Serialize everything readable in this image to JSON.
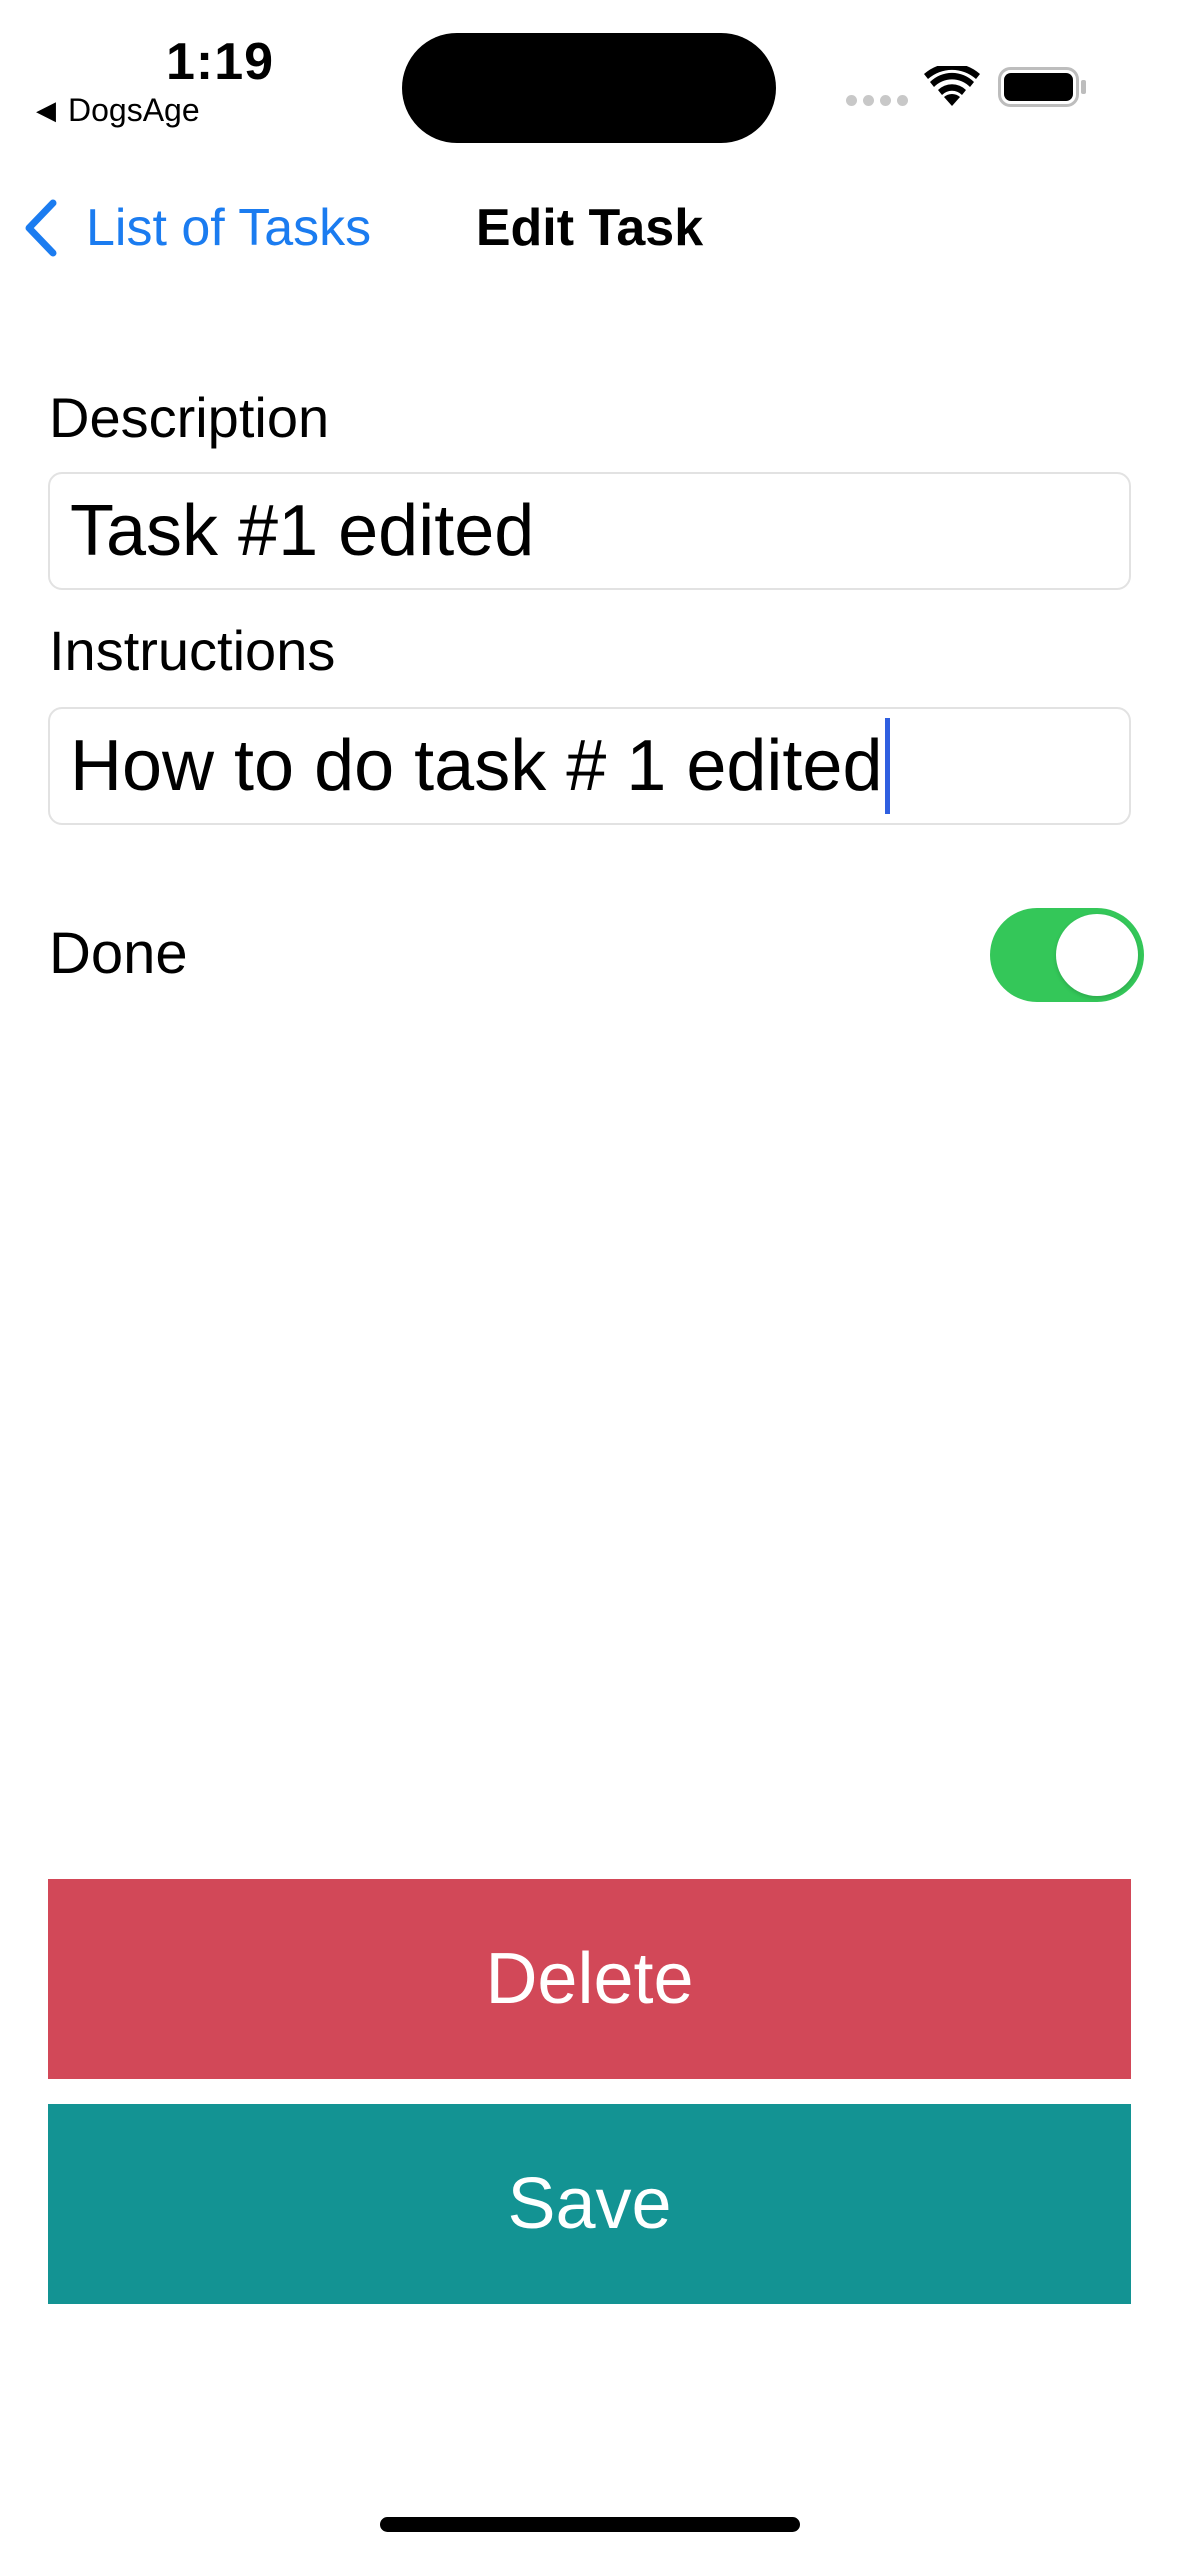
{
  "status_bar": {
    "time": "1:19",
    "back_app": "DogsAge",
    "back_glyph": "◀"
  },
  "nav": {
    "back_label": "List of Tasks",
    "title": "Edit Task"
  },
  "form": {
    "description_label": "Description",
    "description_value": "Task #1 edited",
    "instructions_label": "Instructions",
    "instructions_value": "How to do task # 1 edited",
    "done_label": "Done",
    "done_on": true
  },
  "buttons": {
    "delete_label": "Delete",
    "save_label": "Save"
  },
  "colors": {
    "accent": "#1b7cf0",
    "toggle_on": "#34c759",
    "delete": "#d24858",
    "save": "#139393"
  },
  "icons": {
    "back": "chevron-left-icon",
    "wifi": "wifi-icon",
    "battery": "battery-icon",
    "cellular": "cellular-signal-icon"
  }
}
